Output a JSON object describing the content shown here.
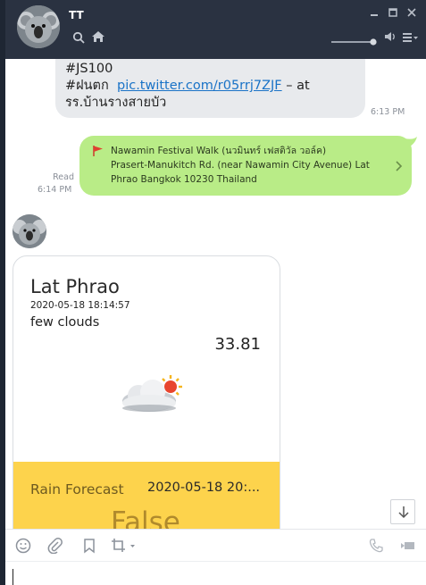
{
  "window": {
    "chat_name": "TT"
  },
  "messages": {
    "incoming_text": {
      "line1": "#JS100",
      "line2_prefix": "#ฝนตก  ",
      "line2_link": "pic.twitter.com/r05rrj7ZJF",
      "line2_suffix": " – at",
      "line3": "รร.บ้านรางสายบัว"
    },
    "incoming_time": "6:13 PM",
    "outgoing_location": {
      "line1": "Nawamin Festival Walk (นวมินทร์ เฟสติวัล วอล์ค)",
      "line2": "Prasert-Manukitch Rd. (near Nawamin City Avenue) Lat",
      "line3": "Phrao Bangkok 10230 Thailand"
    },
    "read_label": "Read",
    "outgoing_time": "6:14 PM"
  },
  "weather_card": {
    "city": "Lat Phrao",
    "datetime": "2020-05-18 18:14:57",
    "description": "few clouds",
    "temperature": "33.81",
    "forecast_label": "Rain Forecast",
    "forecast_time": "2020-05-18 20:...",
    "forecast_value": "False",
    "panel_color": "#fdd34c"
  },
  "colors": {
    "header_bg": "#2a3241",
    "outgoing_bubble": "#b9ec87",
    "incoming_bubble": "#e8eaed",
    "link": "#1a73c7"
  },
  "icons": {
    "header": [
      "search-icon",
      "home-icon",
      "minimize-icon",
      "maximize-icon",
      "close-icon",
      "volume-icon",
      "menu-icon"
    ],
    "toolbar": [
      "emoji-icon",
      "attach-icon",
      "bookmark-icon",
      "crop-icon",
      "call-icon",
      "video-icon"
    ]
  }
}
